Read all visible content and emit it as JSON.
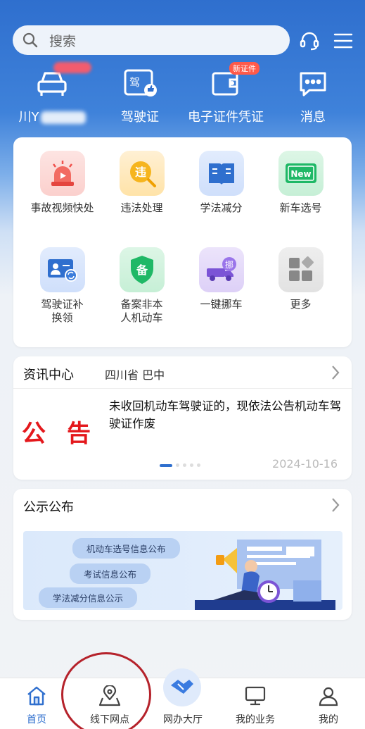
{
  "search": {
    "placeholder": "搜索"
  },
  "quick_actions": [
    {
      "label": "川Y",
      "icon": "car-icon"
    },
    {
      "label": "驾驶证",
      "icon": "license-icon"
    },
    {
      "label": "电子证件凭证",
      "icon": "wallet-icon",
      "badge": "新证件"
    },
    {
      "label": "消息",
      "icon": "message-icon"
    }
  ],
  "services": [
    {
      "label": "事故视频快处",
      "icon": "siren-icon",
      "glyph": ""
    },
    {
      "label": "违法处理",
      "icon": "violation-icon",
      "glyph": "违"
    },
    {
      "label": "学法减分",
      "icon": "book-icon",
      "glyph": ""
    },
    {
      "label": "新车选号",
      "icon": "plate-icon",
      "glyph": "New"
    },
    {
      "label": "驾驶证补换领",
      "icon": "id-card-icon",
      "glyph": ""
    },
    {
      "label": "备案非本人机动车",
      "icon": "shield-icon",
      "glyph": "备"
    },
    {
      "label": "一键挪车",
      "icon": "truck-icon",
      "glyph": "挪"
    },
    {
      "label": "更多",
      "icon": "more-icon",
      "glyph": ""
    }
  ],
  "news": {
    "title": "资讯中心",
    "location": "四川省 巴中",
    "stamp": "公告",
    "headline": "未收回机动车驾驶证的，现依法公告机动车驾驶证作废",
    "date": "2024-10-16"
  },
  "notice": {
    "title": "公示公布",
    "pills": [
      "机动车选号信息公布",
      "考试信息公布",
      "学法减分信息公示"
    ]
  },
  "tabs": [
    {
      "label": "首页",
      "icon": "home-icon"
    },
    {
      "label": "线下网点",
      "icon": "location-pin-icon"
    },
    {
      "label": "网办大厅",
      "icon": "handshake-icon"
    },
    {
      "label": "我的业务",
      "icon": "monitor-icon"
    },
    {
      "label": "我的",
      "icon": "user-icon"
    }
  ],
  "colors": {
    "primary": "#2f6fce",
    "annotation": "#b5222b"
  }
}
